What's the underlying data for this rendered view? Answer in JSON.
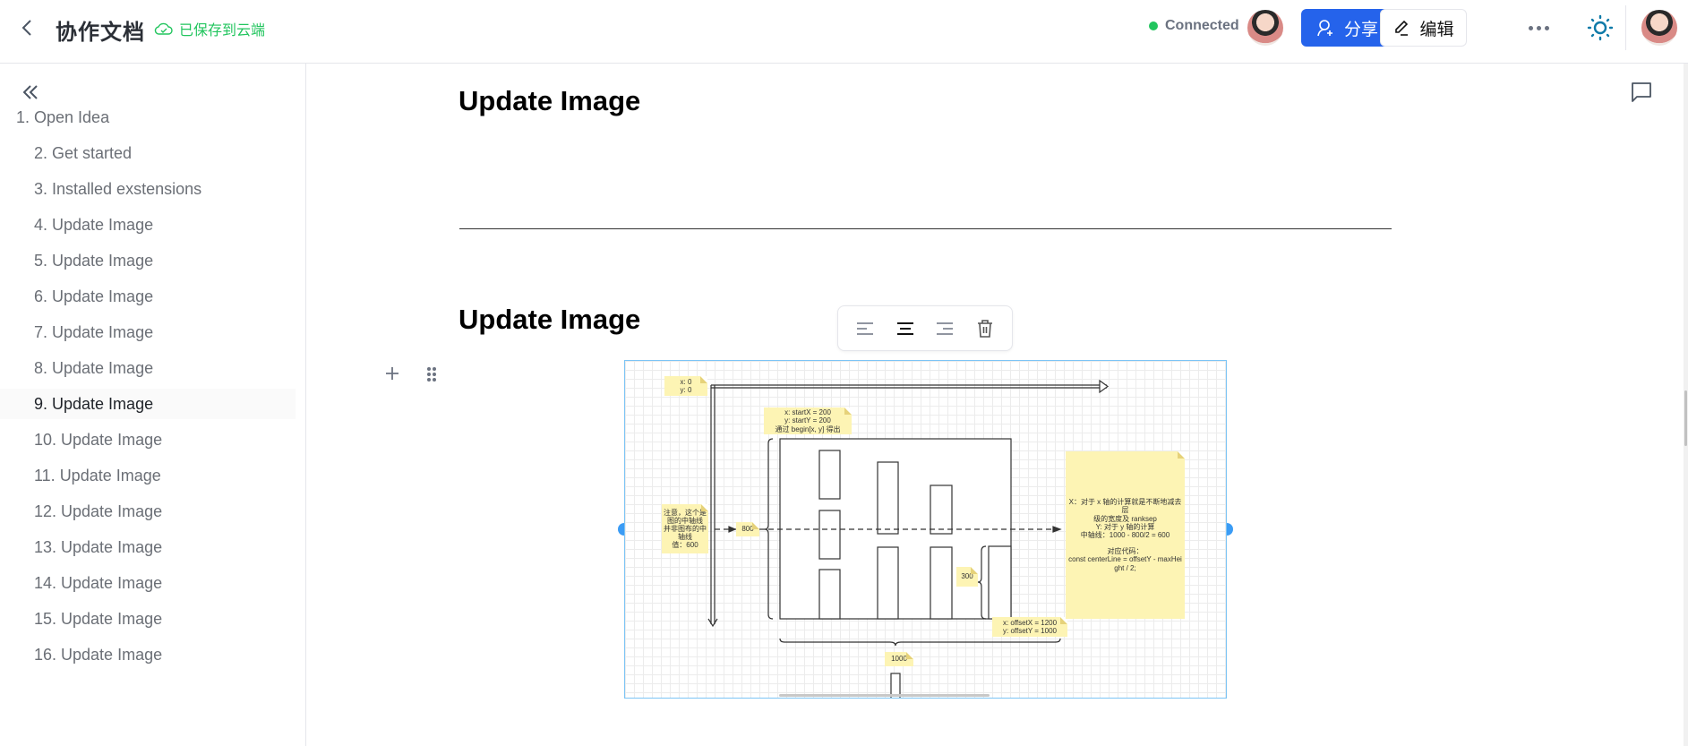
{
  "header": {
    "title": "协作文档",
    "save_status": "已保存到云端",
    "connection_status": "Connected",
    "share_label": "分享",
    "edit_label": "编辑",
    "accent_color": "#2563eb",
    "status_color": "#22c55e"
  },
  "sidebar": {
    "items": [
      {
        "label": "1. Open Idea",
        "level": 1
      },
      {
        "label": "2. Get started",
        "level": 2
      },
      {
        "label": "3. Installed exstensions",
        "level": 2
      },
      {
        "label": "4. Update Image",
        "level": 2
      },
      {
        "label": "5. Update Image",
        "level": 2
      },
      {
        "label": "6. Update Image",
        "level": 2
      },
      {
        "label": "7. Update Image",
        "level": 2
      },
      {
        "label": "8. Update Image",
        "level": 2
      },
      {
        "label": "9. Update Image",
        "level": 2,
        "active": true
      },
      {
        "label": "10. Update Image",
        "level": 2
      },
      {
        "label": "11. Update Image",
        "level": 2
      },
      {
        "label": "12. Update Image",
        "level": 2
      },
      {
        "label": "13. Update Image",
        "level": 2
      },
      {
        "label": "14. Update Image",
        "level": 2
      },
      {
        "label": "15. Update Image",
        "level": 2
      },
      {
        "label": "16. Update Image",
        "level": 2
      }
    ]
  },
  "content": {
    "headings": [
      "Update Image",
      "Update Image"
    ],
    "image_toolbar": [
      "align-left",
      "align-center",
      "align-right",
      "delete"
    ],
    "diagram_notes": {
      "origin": "x:  0\ny:  0",
      "start": "x:  startX = 200\ny:  startY = 200\n通过 begin[x, y] 得出",
      "center_note": "注意，这个是\n图的中轴线\n并非图布的中\n轴线\n值：600",
      "height": "800",
      "small_height": "300",
      "offset": "x:  offsetX = 1200\ny:  offsetY =  1000",
      "width": "1000",
      "explain": "X：对于 x 轴的计算就是不断地减去层\n级的宽度及 ranksep\nY: 对于 y 轴的计算\n中轴线：1000 - 800/2 = 600\n\n对应代码：\nconst centerLine = offsetY - maxHei\nght / 2;"
    }
  }
}
